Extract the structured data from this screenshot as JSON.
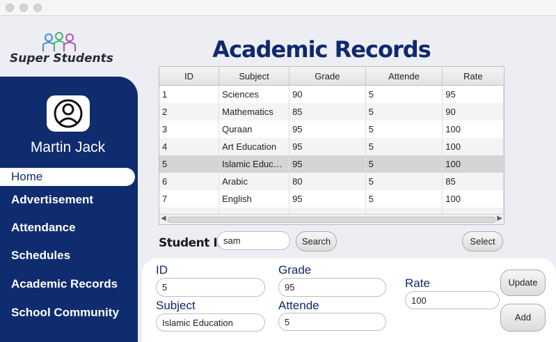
{
  "app": {
    "logo_text": "Super Students",
    "username": "Martin Jack"
  },
  "nav": [
    {
      "label": "Home"
    },
    {
      "label": "Advertisement"
    },
    {
      "label": "Attendance"
    },
    {
      "label": "Schedules"
    },
    {
      "label": "Academic Records"
    },
    {
      "label": "School Community"
    }
  ],
  "page": {
    "title": "Academic Records"
  },
  "table": {
    "columns": [
      "ID",
      "Subject",
      "Grade",
      "Attende",
      "Rate"
    ],
    "rows": [
      [
        "1",
        "Sciences",
        "90",
        "5",
        "95"
      ],
      [
        "2",
        "Mathematics",
        "85",
        "5",
        "90"
      ],
      [
        "3",
        "Quraan",
        "95",
        "5",
        "100"
      ],
      [
        "4",
        "Art Education",
        "95",
        "5",
        "100"
      ],
      [
        "5",
        "Islamic Educat...",
        "95",
        "5",
        "100"
      ],
      [
        "6",
        "Arabic",
        "80",
        "5",
        "85"
      ],
      [
        "7",
        "English",
        "95",
        "5",
        "100"
      ]
    ]
  },
  "search": {
    "label": "Student ID",
    "value": "sam",
    "search_button": "Search",
    "select_button": "Select"
  },
  "form": {
    "id_label": "ID",
    "id_value": "5",
    "subject_label": "Subject",
    "subject_value": "Islamic Education",
    "grade_label": "Grade",
    "grade_value": "95",
    "attende_label": "Attende",
    "attende_value": "5",
    "rate_label": "Rate",
    "rate_value": "100",
    "update_button": "Update",
    "add_button": "Add"
  }
}
